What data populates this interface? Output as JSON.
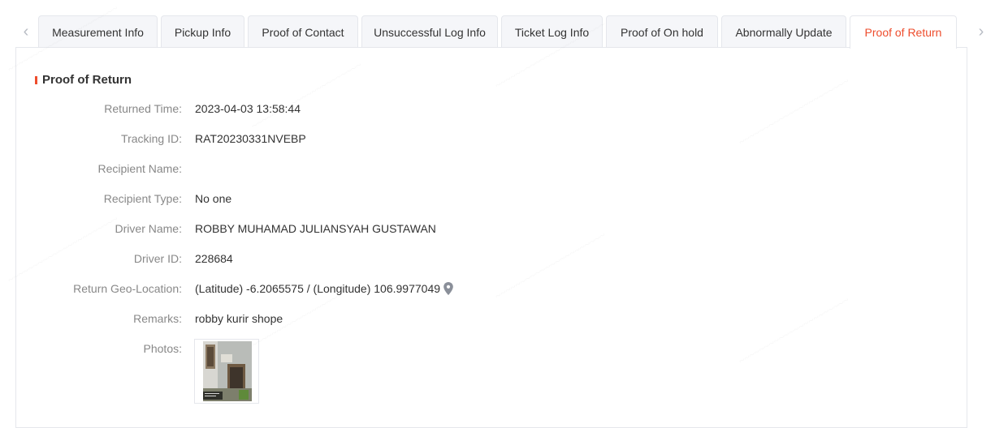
{
  "tabs": [
    {
      "label": "Measurement Info",
      "active": false
    },
    {
      "label": "Pickup Info",
      "active": false
    },
    {
      "label": "Proof of Contact",
      "active": false
    },
    {
      "label": "Unsuccessful Log Info",
      "active": false
    },
    {
      "label": "Ticket Log Info",
      "active": false
    },
    {
      "label": "Proof of On hold",
      "active": false
    },
    {
      "label": "Abnormally Update",
      "active": false
    },
    {
      "label": "Proof of Return",
      "active": true
    }
  ],
  "section": {
    "title": "Proof of Return"
  },
  "fields": {
    "returned_time": {
      "label": "Returned Time:",
      "value": "2023-04-03 13:58:44"
    },
    "tracking_id": {
      "label": "Tracking ID:",
      "value": "RAT20230331NVEBP"
    },
    "recipient_name": {
      "label": "Recipient Name:",
      "value": ""
    },
    "recipient_type": {
      "label": "Recipient Type:",
      "value": "No one"
    },
    "driver_name": {
      "label": "Driver Name:",
      "value": "ROBBY MUHAMAD JULIANSYAH GUSTAWAN"
    },
    "driver_id": {
      "label": "Driver ID:",
      "value": "228684"
    },
    "geo_location": {
      "label": "Return Geo-Location:",
      "value": "(Latitude) -6.2065575 / (Longitude) 106.9977049"
    },
    "remarks": {
      "label": "Remarks:",
      "value": "robby kurir shope"
    },
    "photos": {
      "label": "Photos:"
    }
  },
  "colors": {
    "accent": "#ee4d2d",
    "label": "#888888",
    "text": "#333333"
  }
}
